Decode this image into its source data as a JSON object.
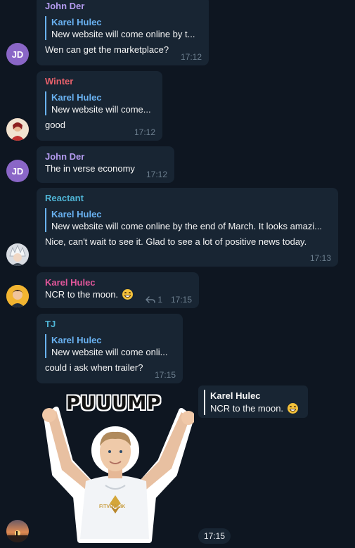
{
  "messages": [
    {
      "sender": "John Der",
      "reply_name": "Karel Hulec",
      "reply_text": "New website will come online by t...",
      "text": "Wen can get the marketplace?",
      "time": "17:12"
    },
    {
      "sender": "Winter",
      "reply_name": "Karel Hulec",
      "reply_text": "New website will come...",
      "text": "good",
      "time": "17:12"
    },
    {
      "sender": "John Der",
      "text": "The in verse economy",
      "time": "17:12"
    },
    {
      "sender": "Reactant",
      "reply_name": "Karel Hulec",
      "reply_text": "New website will come online by the end of March. It looks amazi...",
      "text": "Nice, can't wait to see it. Glad to see a lot of positive news today.",
      "time": "17:13"
    },
    {
      "sender": "Karel Hulec",
      "text": "NCR to the moon.",
      "emoji": "grinning-face",
      "replies": "1",
      "time": "17:15"
    },
    {
      "sender": "TJ",
      "reply_name": "Karel Hulec",
      "reply_text": "New website will come onli...",
      "text": "could i ask when trailer?",
      "time": "17:15"
    }
  ],
  "sticker": {
    "caption": "PUUUMP",
    "shirt_text": "FITVITALIK",
    "reply_name": "Karel Hulec",
    "reply_text": "NCR to the moon.",
    "time": "17:15"
  },
  "avatars": {
    "john_der": "JD"
  },
  "colors": {
    "background": "#0e1621",
    "bubble": "#182533",
    "accent": "#6ab3f3",
    "time": "#6d7f8f"
  }
}
